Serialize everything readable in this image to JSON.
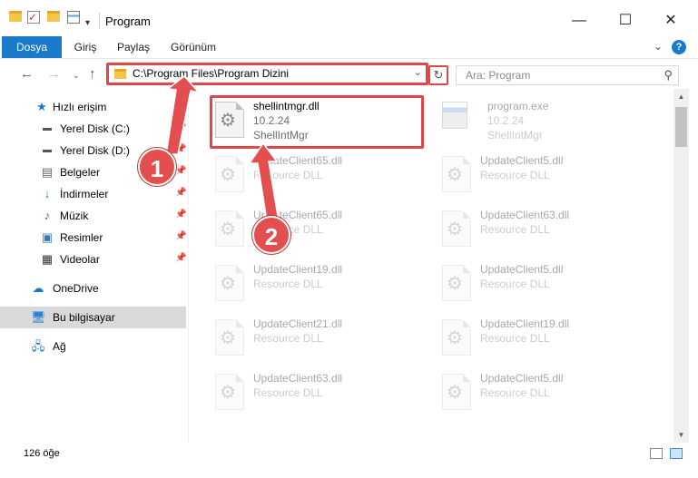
{
  "window": {
    "title": "Program",
    "minimize": "—",
    "maximize": "☐",
    "close": "✕"
  },
  "ribbon": {
    "tabs": [
      "Dosya",
      "Giriş",
      "Paylaş",
      "Görünüm"
    ],
    "expand": "⌄",
    "help": "?"
  },
  "address": {
    "path": "C:\\Program Files\\Program Dizini",
    "search_placeholder": "Ara: Program"
  },
  "nav": {
    "items": [
      {
        "label": "Hızlı erişim",
        "icon": "star-icon"
      },
      {
        "label": "Yerel Disk (C:)",
        "icon": "drive-icon",
        "pinned": true
      },
      {
        "label": "Yerel Disk (D:)",
        "icon": "drive-icon",
        "pinned": true
      },
      {
        "label": "Belgeler",
        "icon": "documents-icon",
        "pinned": true
      },
      {
        "label": "İndirmeler",
        "icon": "downloads-icon",
        "pinned": true
      },
      {
        "label": "Müzik",
        "icon": "music-icon",
        "pinned": true
      },
      {
        "label": "Resimler",
        "icon": "pictures-icon",
        "pinned": true
      },
      {
        "label": "Videolar",
        "icon": "videos-icon",
        "pinned": true
      },
      {
        "label": "OneDrive",
        "icon": "cloud-icon"
      },
      {
        "label": "Bu bilgisayar",
        "icon": "computer-icon",
        "selected": true
      },
      {
        "label": "Ağ",
        "icon": "network-icon"
      }
    ]
  },
  "files": [
    {
      "name": "shellintmgr.dll",
      "line2": "10.2.24",
      "line3": "ShellIntMgr",
      "highlighted": true
    },
    {
      "name": "program.exe",
      "line2": "10.2.24",
      "line3": "ShellIntMgr",
      "faded": true
    },
    {
      "name": "UpdateClient65.dll",
      "line2": "Resource DLL",
      "faded": true
    },
    {
      "name": "UpdateClient5.dll",
      "line2": "Resource DLL",
      "faded": true
    },
    {
      "name": "UpdateClient65.dll",
      "line2": "Resource DLL",
      "faded": true
    },
    {
      "name": "UpdateClient63.dll",
      "line2": "Resource DLL",
      "faded": true
    },
    {
      "name": "UpdateClient19.dll",
      "line2": "Resource DLL",
      "faded": true
    },
    {
      "name": "UpdateClient5.dll",
      "line2": "Resource DLL",
      "faded": true
    },
    {
      "name": "UpdateClient21.dll",
      "line2": "Resource DLL",
      "faded": true
    },
    {
      "name": "UpdateClient19.dll",
      "line2": "Resource DLL",
      "faded": true
    },
    {
      "name": "UpdateClient63.dll",
      "line2": "Resource DLL",
      "faded": true
    },
    {
      "name": "UpdateClient5.dll",
      "line2": "Resource DLL",
      "faded": true
    }
  ],
  "status": {
    "count": "126 öğe"
  },
  "annotations": {
    "step1": "1",
    "step2": "2",
    "color": "#e34f4f"
  }
}
